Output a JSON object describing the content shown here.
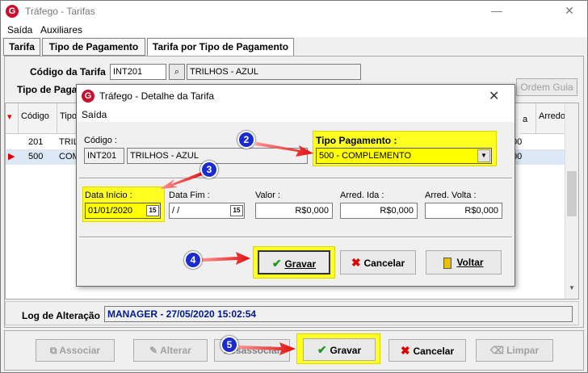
{
  "app": {
    "title": "Tráfego - Tarifas",
    "logo": "G"
  },
  "window_controls": {
    "minimize": "—",
    "close": "✕"
  },
  "menu": [
    "Saída",
    "Auxiliares"
  ],
  "tabs": [
    "Tarifa",
    "Tipo de Pagamento",
    "Tarifa por Tipo de Pagamento"
  ],
  "form": {
    "codigo_label": "Código da Tarifa",
    "codigo_value": "INT201",
    "desc_value": "TRILHOS - AZUL",
    "tipo_label": "Tipo de Paga",
    "ordem_btn": "Ordem Guia"
  },
  "grid": {
    "headers": [
      "Código",
      "Tipo",
      "Arredon"
    ],
    "header_cut": "a",
    "rows": [
      {
        "codigo": "201",
        "tipo": "TRIL",
        "val": "00"
      },
      {
        "codigo": "500",
        "tipo": "COM",
        "val": "00"
      }
    ]
  },
  "log": {
    "label": "Log de Alteração",
    "value": "MANAGER - 27/05/2020 15:02:54"
  },
  "bottom_buttons": [
    "Associar",
    "Alterar",
    "Desassociar",
    "Gravar",
    "Cancelar",
    "Limpar"
  ],
  "dialog": {
    "title": "Tráfego - Detalhe da Tarifa",
    "menu": "Saída",
    "codigo_label": "Código :",
    "codigo_value": "INT201",
    "desc_value": "TRILHOS - AZUL",
    "tipo_label": "Tipo Pagamento :",
    "tipo_value": "500 - COMPLEMENTO",
    "data_inicio_label": "Data Início :",
    "data_inicio_value": "01/01/2020",
    "data_fim_label": "Data Fim :",
    "data_fim_value": " /  /",
    "valor_label": "Valor :",
    "valor_value": "R$0,000",
    "arred_ida_label": "Arred. Ida :",
    "arred_ida_value": "R$0,000",
    "arred_volta_label": "Arred. Volta :",
    "arred_volta_value": "R$0,000",
    "cal_icon_text": "15",
    "buttons": [
      "Gravar",
      "Cancelar",
      "Voltar"
    ]
  },
  "steps": [
    "2",
    "3",
    "4",
    "5"
  ],
  "colors": {
    "highlight": "#ffff22",
    "step_circle": "#1a2bd0",
    "arrow": "#e03030",
    "selected_row": "#dce8f5"
  }
}
